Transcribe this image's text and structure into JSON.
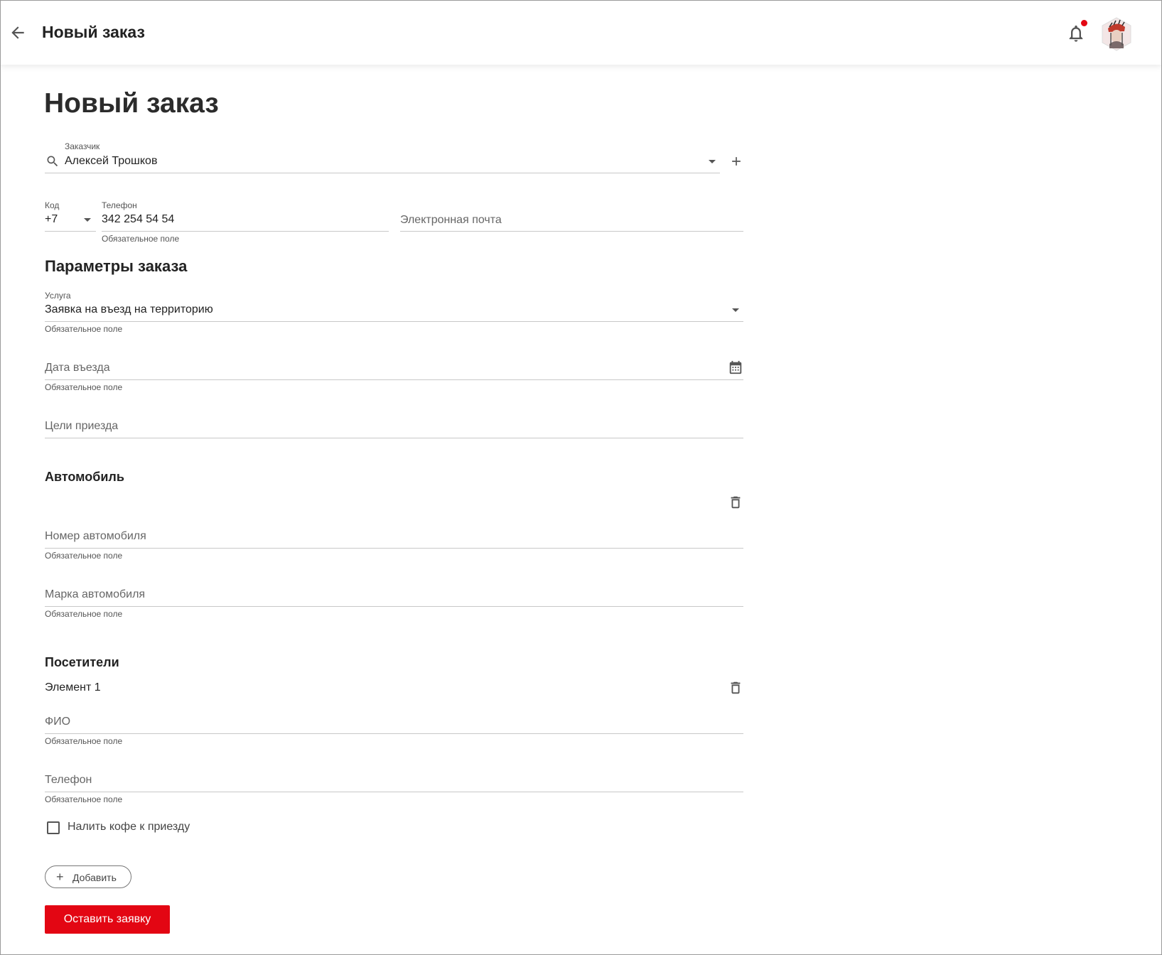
{
  "header": {
    "title": "Новый заказ"
  },
  "page": {
    "title": "Новый заказ"
  },
  "customer": {
    "label": "Заказчик",
    "value": "Алексей Трошков"
  },
  "phone": {
    "code_label": "Код",
    "code_value": "+7",
    "phone_label": "Телефон",
    "phone_value": "342 254 54 54",
    "phone_hint": "Обязательное поле",
    "email_placeholder": "Электронная почта"
  },
  "order_params": {
    "title": "Параметры заказа",
    "service_label": "Услуга",
    "service_value": "Заявка на въезд на территорию",
    "service_hint": "Обязательное поле",
    "date_placeholder": "Дата въезда",
    "date_hint": "Обязательное поле",
    "purpose_placeholder": "Цели приезда"
  },
  "car": {
    "title": "Автомобиль",
    "number_placeholder": "Номер автомобиля",
    "number_hint": "Обязательное поле",
    "brand_placeholder": "Марка автомобиля",
    "brand_hint": "Обязательное поле"
  },
  "visitors": {
    "title": "Посетители",
    "item_title": "Элемент 1",
    "name_placeholder": "ФИО",
    "name_hint": "Обязательное поле",
    "phone_placeholder": "Телефон",
    "phone_hint": "Обязательное поле",
    "coffee_label": "Налить кофе к приезду",
    "coffee_checked": false
  },
  "actions": {
    "add_label": "Добавить",
    "submit_label": "Оставить заявку"
  },
  "colors": {
    "accent": "#e30613",
    "notification_dot": "#e30613"
  },
  "icons": [
    "arrow-back-icon",
    "bell-icon",
    "avatar",
    "search-icon",
    "chevron-down-icon",
    "plus-icon",
    "calendar-icon",
    "trash-icon",
    "checkbox"
  ]
}
